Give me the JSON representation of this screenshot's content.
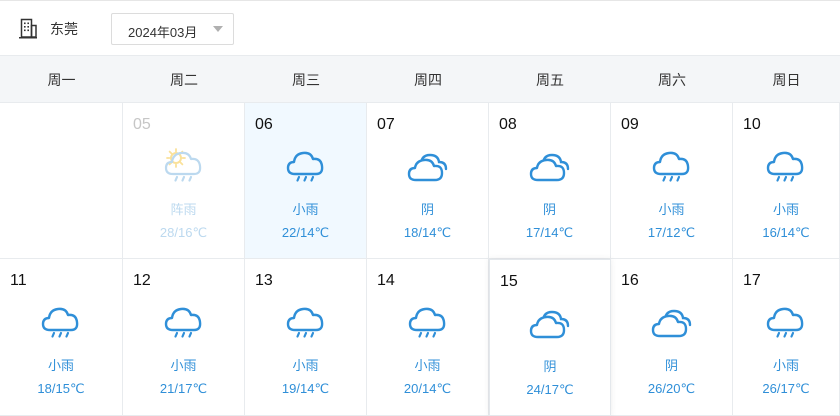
{
  "header": {
    "city_icon": "building-icon",
    "city": "东莞",
    "month": "2024年03月",
    "dropdown_icon": "caret-down-icon"
  },
  "weekdays": [
    "周一",
    "周二",
    "周三",
    "周四",
    "周五",
    "周六",
    "周日"
  ],
  "colors": {
    "accent": "#2f8fd8",
    "muted": "#bcd9ef",
    "today_bg": "#f1f9ff",
    "weekbar_bg": "#f4f6f8",
    "sun": "#f7c948"
  },
  "weeks": [
    [
      null,
      {
        "day": "05",
        "icon": "sun-cloud-rain-icon",
        "desc": "阵雨",
        "temp": "28/16℃",
        "state": "past"
      },
      {
        "day": "06",
        "icon": "cloud-rain-icon",
        "desc": "小雨",
        "temp": "22/14℃",
        "state": "today"
      },
      {
        "day": "07",
        "icon": "overcast-icon",
        "desc": "阴",
        "temp": "18/14℃",
        "state": ""
      },
      {
        "day": "08",
        "icon": "overcast-icon",
        "desc": "阴",
        "temp": "17/14℃",
        "state": ""
      },
      {
        "day": "09",
        "icon": "cloud-rain-icon",
        "desc": "小雨",
        "temp": "17/12℃",
        "state": ""
      },
      {
        "day": "10",
        "icon": "cloud-rain-icon",
        "desc": "小雨",
        "temp": "16/14℃",
        "state": ""
      }
    ],
    [
      {
        "day": "11",
        "icon": "cloud-rain-icon",
        "desc": "小雨",
        "temp": "18/15℃",
        "state": ""
      },
      {
        "day": "12",
        "icon": "cloud-rain-icon",
        "desc": "小雨",
        "temp": "21/17℃",
        "state": ""
      },
      {
        "day": "13",
        "icon": "cloud-rain-icon",
        "desc": "小雨",
        "temp": "19/14℃",
        "state": ""
      },
      {
        "day": "14",
        "icon": "cloud-rain-icon",
        "desc": "小雨",
        "temp": "20/14℃",
        "state": ""
      },
      {
        "day": "15",
        "icon": "overcast-icon",
        "desc": "阴",
        "temp": "24/17℃",
        "state": "highlight"
      },
      {
        "day": "16",
        "icon": "overcast-icon",
        "desc": "阴",
        "temp": "26/20℃",
        "state": ""
      },
      {
        "day": "17",
        "icon": "cloud-rain-icon",
        "desc": "小雨",
        "temp": "26/17℃",
        "state": ""
      }
    ]
  ]
}
